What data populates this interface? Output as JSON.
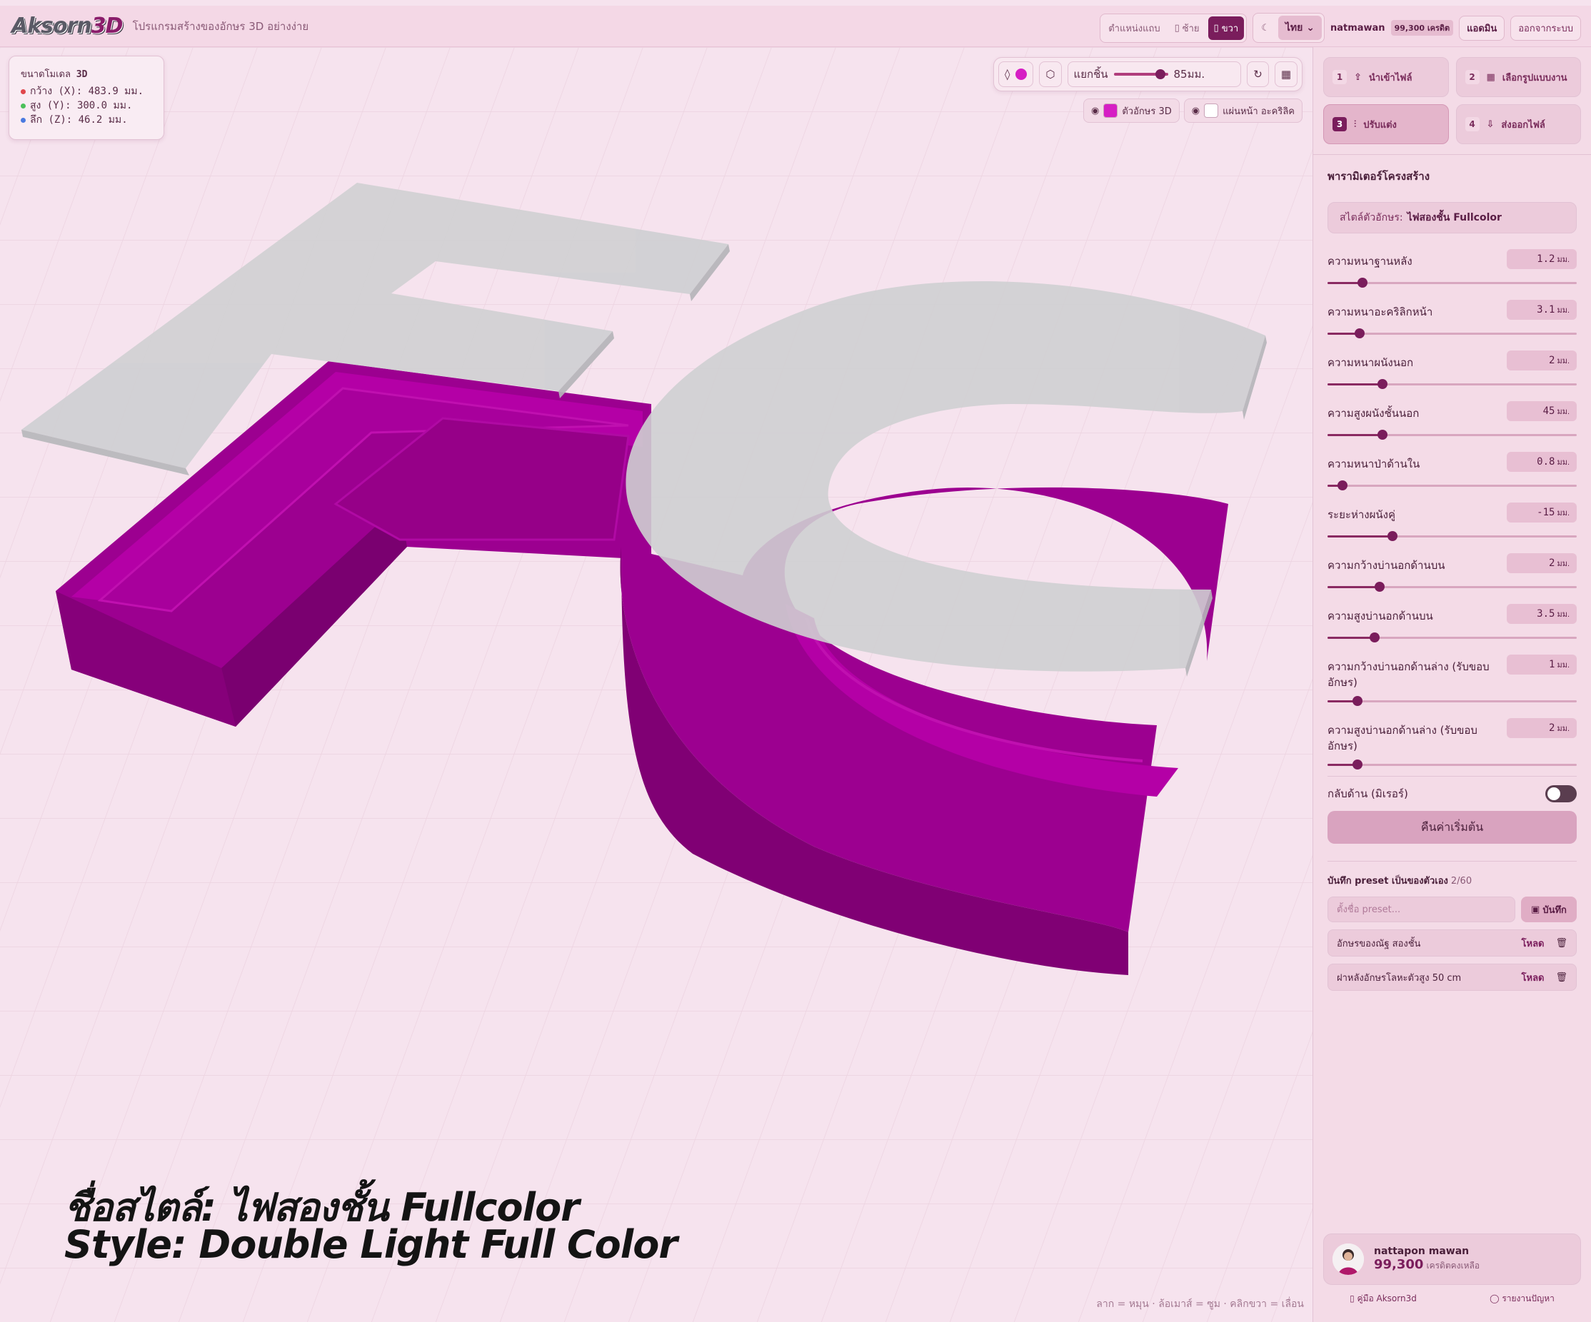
{
  "header": {
    "logo_main": "Aksorn",
    "logo_accent": "3D",
    "tagline": "โปรแกรมสร้างของอักษร 3D อย่างง่าย",
    "position_label": "ตำแหน่งแถบ",
    "left_label": "ซ้าย",
    "right_label": "ขวา",
    "language": "ไทย",
    "username": "natmawan",
    "credit_badge": "99,300 เครดิต",
    "admin_label": "แอดมิน",
    "logout_label": "ออกจากระบบ"
  },
  "viewport": {
    "dims_title": "ขนาดโมเดล",
    "dims_title_bold": "3D",
    "dims": [
      {
        "label": "กว้าง (X): 483.9 มม.",
        "color": "#e0474c"
      },
      {
        "label": "สูง (Y): 300.0 มม.",
        "color": "#4cc05a"
      },
      {
        "label": "ลึก (Z): 46.2 มม.",
        "color": "#4a7ae0"
      }
    ],
    "explode_label": "แยกชิ้น",
    "explode_value": "85มม.",
    "layer_letter": "ตัวอักษร 3D",
    "layer_front": "แผ่นหน้า อะคริลิค",
    "letter_color": "#d61ec4",
    "front_color": "#ffffff",
    "overlay_line1": "ชื่อสไตล์: ไฟสองชั้น Fullcolor",
    "overlay_line2": "Style: Double Light Full Color",
    "hint": "ลาก = หมุน · ล้อเมาส์ = ซูม · คลิกขวา = เลื่อน"
  },
  "steps": [
    {
      "n": "1",
      "label": "นำเข้าไฟล์",
      "icon": "upload-icon",
      "active": false
    },
    {
      "n": "2",
      "label": "เลือกรูปแบบงาน",
      "icon": "grid-icon",
      "active": false
    },
    {
      "n": "3",
      "label": "ปรับแต่ง",
      "icon": "sliders-icon",
      "active": true
    },
    {
      "n": "4",
      "label": "ส่งออกไฟล์",
      "icon": "download-icon",
      "active": false
    }
  ],
  "params_title": "พารามิเตอร์โครงสร้าง",
  "style_label": "สไตล์ตัวอักษร:",
  "style_value": "ไฟสองชั้น Fullcolor",
  "params": [
    {
      "label": "ความหนาฐานหลัง",
      "value": "1.2",
      "unit": "มม.",
      "pos": 0.14
    },
    {
      "label": "ความหนาอะคริลิกหน้า",
      "value": "3.1",
      "unit": "มม.",
      "pos": 0.13
    },
    {
      "label": "ความหนาผนังนอก",
      "value": "2",
      "unit": "มม.",
      "pos": 0.22
    },
    {
      "label": "ความสูงผนังชั้นนอก",
      "value": "45",
      "unit": "มม.",
      "pos": 0.22
    },
    {
      "label": "ความหนาป่าด้านใน",
      "value": "0.8",
      "unit": "มม.",
      "pos": 0.06
    },
    {
      "label": "ระยะห่างผนังคู่",
      "value": "-15",
      "unit": "มม.",
      "pos": 0.26
    },
    {
      "label": "ความกว้างบ่านอกด้านบน",
      "value": "2",
      "unit": "มม.",
      "pos": 0.21
    },
    {
      "label": "ความสูงบ่านอกด้านบน",
      "value": "3.5",
      "unit": "มม.",
      "pos": 0.19
    },
    {
      "label": "ความกว้างบ่านอกด้านล่าง (รับขอบอักษร)",
      "value": "1",
      "unit": "มม.",
      "pos": 0.12
    },
    {
      "label": "ความสูงบ่านอกด้านล่าง (รับขอบอักษร)",
      "value": "2",
      "unit": "มม.",
      "pos": 0.12
    }
  ],
  "mirror_label": "กลับด้าน (มิเรอร์)",
  "reset_label": "คืนค่าเริ่มต้น",
  "preset_title": "บันทึก preset เป็นของตัวเอง",
  "preset_count": "2/60",
  "preset_placeholder": "ตั้งชื่อ preset...",
  "preset_save": "บันทึก",
  "presets": [
    {
      "name": "อักษรของณัฐ สองชั้น",
      "load": "โหลด"
    },
    {
      "name": "ฝาหลังอักษรโลหะตัวสูง 50 cm",
      "load": "โหลด"
    }
  ],
  "profile": {
    "name": "nattapon mawan",
    "credits": "99,300",
    "credits_label": "เครดิตคงเหลือ"
  },
  "footer": {
    "guide": "คู่มือ Aksorn3d",
    "report": "รายงานปัญหา"
  }
}
